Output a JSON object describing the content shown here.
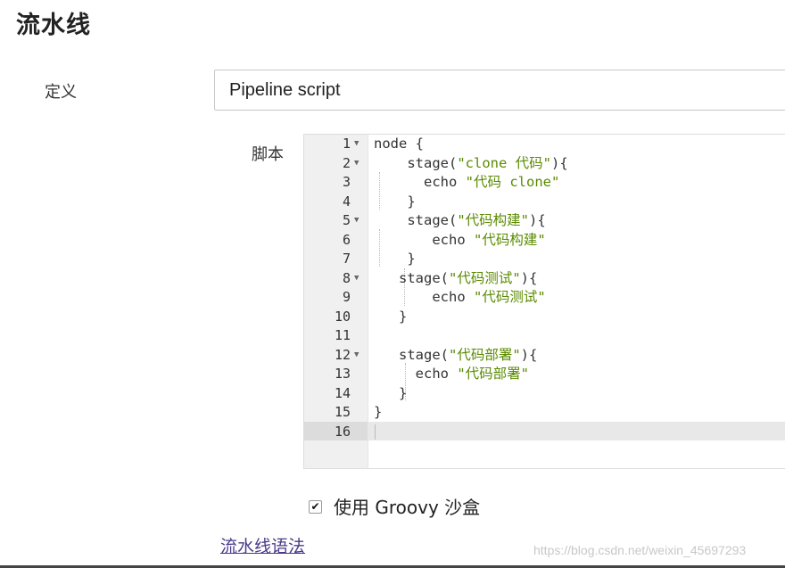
{
  "page": {
    "title": "流水线"
  },
  "definition": {
    "label": "定义",
    "value": "Pipeline script"
  },
  "script": {
    "label": "脚本",
    "lines": [
      {
        "n": "1",
        "fold": true,
        "parts": [
          [
            "p",
            "node {"
          ]
        ]
      },
      {
        "n": "2",
        "fold": true,
        "parts": [
          [
            "p",
            "    stage("
          ],
          [
            "s",
            "\"clone 代码\""
          ],
          [
            "p",
            "){"
          ]
        ]
      },
      {
        "n": "3",
        "fold": false,
        "parts": [
          [
            "p",
            "      echo "
          ],
          [
            "s",
            "\"代码 clone\""
          ]
        ]
      },
      {
        "n": "4",
        "fold": false,
        "parts": [
          [
            "p",
            "    }"
          ]
        ]
      },
      {
        "n": "5",
        "fold": true,
        "parts": [
          [
            "p",
            "    stage("
          ],
          [
            "s",
            "\"代码构建\""
          ],
          [
            "p",
            "){"
          ]
        ]
      },
      {
        "n": "6",
        "fold": false,
        "parts": [
          [
            "p",
            "       echo "
          ],
          [
            "s",
            "\"代码构建\""
          ]
        ]
      },
      {
        "n": "7",
        "fold": false,
        "parts": [
          [
            "p",
            "    }"
          ]
        ]
      },
      {
        "n": "8",
        "fold": true,
        "parts": [
          [
            "p",
            "   stage("
          ],
          [
            "s",
            "\"代码测试\""
          ],
          [
            "p",
            "){"
          ]
        ]
      },
      {
        "n": "9",
        "fold": false,
        "parts": [
          [
            "p",
            "       echo "
          ],
          [
            "s",
            "\"代码测试\""
          ]
        ]
      },
      {
        "n": "10",
        "fold": false,
        "parts": [
          [
            "p",
            "   }"
          ]
        ]
      },
      {
        "n": "11",
        "fold": false,
        "parts": []
      },
      {
        "n": "12",
        "fold": true,
        "parts": [
          [
            "p",
            "   stage("
          ],
          [
            "s",
            "\"代码部署\""
          ],
          [
            "p",
            "){"
          ]
        ]
      },
      {
        "n": "13",
        "fold": false,
        "parts": [
          [
            "p",
            "     echo "
          ],
          [
            "s",
            "\"代码部署\""
          ]
        ]
      },
      {
        "n": "14",
        "fold": false,
        "parts": [
          [
            "p",
            "   }"
          ]
        ]
      },
      {
        "n": "15",
        "fold": false,
        "parts": [
          [
            "p",
            "}"
          ]
        ]
      },
      {
        "n": "16",
        "fold": false,
        "parts": []
      }
    ]
  },
  "sandbox": {
    "label": "使用 Groovy 沙盒",
    "checked": true,
    "check_glyph": "✔"
  },
  "links": {
    "syntax": "流水线语法"
  },
  "watermark": "https://blog.csdn.net/weixin_45697293"
}
